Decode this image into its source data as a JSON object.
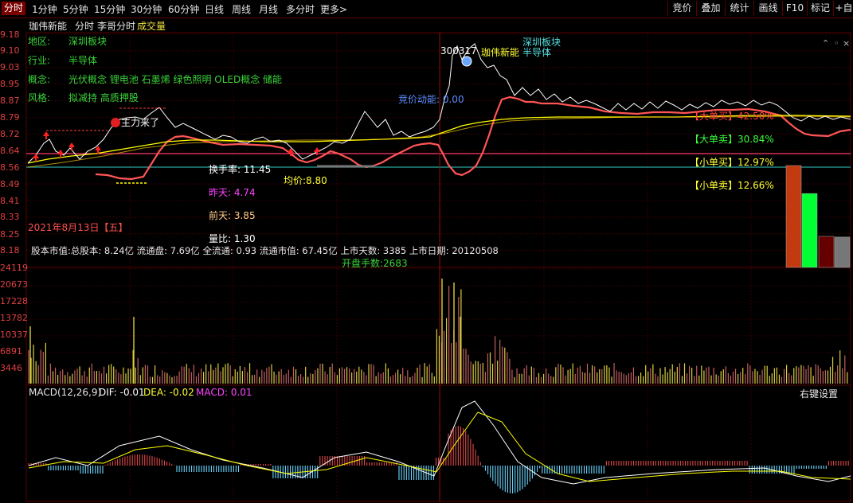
{
  "tabs": [
    "分时",
    "1分钟",
    "5分钟",
    "15分钟",
    "30分钟",
    "60分钟",
    "日线",
    "周线",
    "月线",
    "多分时",
    "更多>"
  ],
  "right_buttons": [
    "竞价",
    "叠加",
    "统计",
    "画线",
    "F10",
    "标记",
    "+自"
  ],
  "title": {
    "stock": "珈伟新能",
    "mode": "分时",
    "indicator": "李哥分时",
    "volume": "成交量"
  },
  "price_axis": [
    "9.18",
    "9.10",
    "9.03",
    "8.95",
    "8.87",
    "8.79",
    "8.72",
    "8.64",
    "8.56",
    "8.49",
    "8.41",
    "8.33",
    "8.25",
    "8.18"
  ],
  "volume_axis": [
    "24119",
    "20673",
    "17228",
    "13782",
    "10337",
    "6891",
    "3446"
  ],
  "info": {
    "region_label": "地区:",
    "region": "深圳板块",
    "industry_label": "行业:",
    "industry": "半导体",
    "concept_label": "概念:",
    "concept": "光伏概念 锂电池 石墨烯 绿色照明 OLED概念 储能",
    "style_label": "风格:",
    "style": "拟减持 高质押股"
  },
  "annotations": {
    "code": "300317",
    "name": "珈伟新能",
    "board_top": "深圳板块",
    "industry_top": "半导体",
    "auction": "竞价动能:  0.00",
    "main_force": "主力来了",
    "turnover": "换手率: 11.45",
    "avg_price": "均价:8.80",
    "yesterday": "昨天: 4.74",
    "before_yesterday": "前天: 3.85",
    "vol_ratio": "量比: 1.30",
    "date": "2021年8月13日【五】",
    "fundamentals": "股本市值:总股本: 8.24亿 流通盘: 7.69亿 全流通: 0.93 流通市值: 67.45亿 上市天数: 3385 上市日期: 20120508",
    "open_hands": "开盘手数:2683"
  },
  "orders": {
    "big_buy": "【大单买】42.50%",
    "big_sell": "【大单卖】30.84%",
    "small_buy": "【小单买】12.97%",
    "small_sell": "【小单卖】12.66%",
    "values": [
      42.5,
      30.84,
      12.97,
      12.66
    ],
    "colors": [
      "#c23a10",
      "#00ff33",
      "#660000",
      "#777777"
    ]
  },
  "macd": {
    "title": "MACD(12,26,9)",
    "dif": "DIF: -0.01",
    "dea": "DEA: -0.02",
    "macd": "MACD: 0.01",
    "settings": "右键设置"
  },
  "colors": {
    "price_line": "#ffffff",
    "avg_line": "#ffff00",
    "li_line": "#ff5555",
    "grid": "#5a0000",
    "axis_text": "#e04040"
  }
}
